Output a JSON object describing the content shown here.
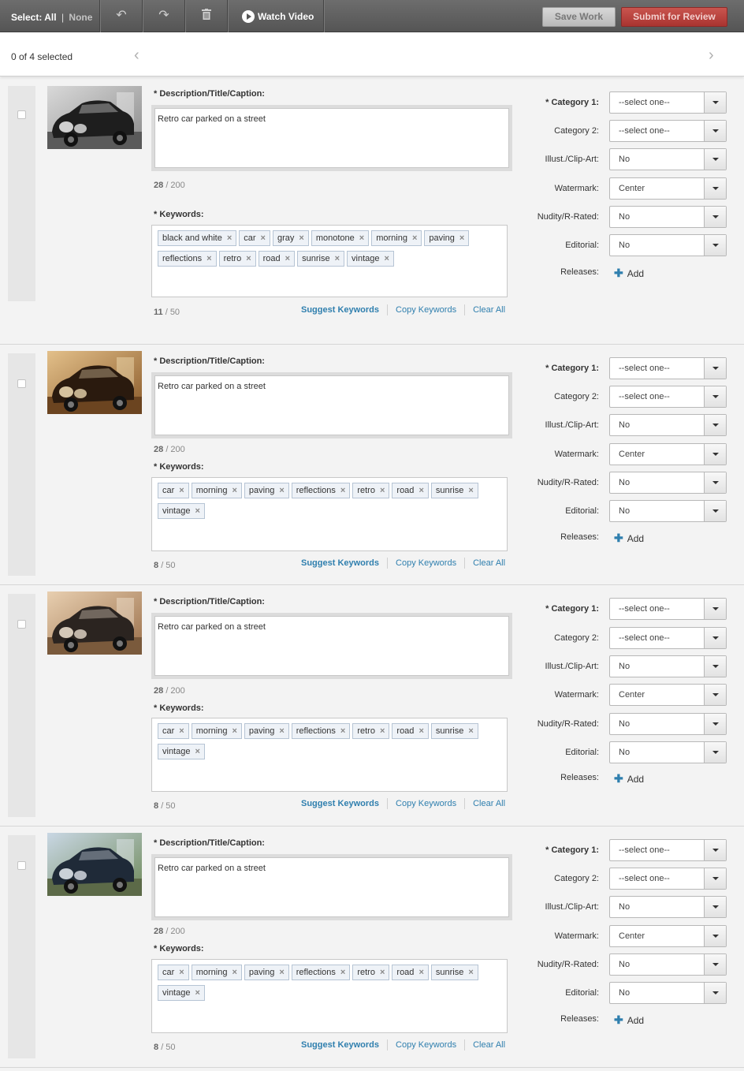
{
  "toolbar": {
    "select_label": "Select:",
    "select_all": "All",
    "select_divider": "|",
    "select_none": "None",
    "undo_icon": "↶",
    "redo_icon": "↷",
    "trash_icon": "🗑",
    "watch_video": "Watch Video",
    "save_work": "Save Work",
    "submit_review": "Submit for Review"
  },
  "selection": {
    "count_text": "0 of 4 selected",
    "prev": "‹",
    "next": "›"
  },
  "labels": {
    "description": "* Description/Title/Caption:",
    "keywords": "* Keywords:",
    "suggest": "Suggest Keywords",
    "copy": "Copy Keywords",
    "clear": "Clear All",
    "category1": "* Category 1:",
    "category2": "Category 2:",
    "illust": "Illust./Clip-Art:",
    "watermark": "Watermark:",
    "nudity": "Nudity/R-Rated:",
    "editorial": "Editorial:",
    "releases": "Releases:",
    "add": "Add",
    "remove_x": "×",
    "plus": "✚"
  },
  "items": [
    {
      "description": "Retro car parked on a street",
      "desc_count": "28",
      "desc_max": "/ 200",
      "keywords": [
        "black and white",
        "car",
        "gray",
        "monotone",
        "morning",
        "paving",
        "reflections",
        "retro",
        "road",
        "sunrise",
        "vintage"
      ],
      "kw_count": "11",
      "kw_max": "/ 50",
      "category1": "--select one--",
      "category2": "--select one--",
      "illust": "No",
      "watermark": "Center",
      "nudity": "No",
      "editorial": "No"
    },
    {
      "description": "Retro car parked on a street",
      "desc_count": "28",
      "desc_max": "/ 200",
      "keywords": [
        "car",
        "morning",
        "paving",
        "reflections",
        "retro",
        "road",
        "sunrise",
        "vintage"
      ],
      "kw_count": "8",
      "kw_max": "/ 50",
      "category1": "--select one--",
      "category2": "--select one--",
      "illust": "No",
      "watermark": "Center",
      "nudity": "No",
      "editorial": "No"
    },
    {
      "description": "Retro car parked on a street",
      "desc_count": "28",
      "desc_max": "/ 200",
      "keywords": [
        "car",
        "morning",
        "paving",
        "reflections",
        "retro",
        "road",
        "sunrise",
        "vintage"
      ],
      "kw_count": "8",
      "kw_max": "/ 50",
      "category1": "--select one--",
      "category2": "--select one--",
      "illust": "No",
      "watermark": "Center",
      "nudity": "No",
      "editorial": "No"
    },
    {
      "description": "Retro car parked on a street",
      "desc_count": "28",
      "desc_max": "/ 200",
      "keywords": [
        "car",
        "morning",
        "paving",
        "reflections",
        "retro",
        "road",
        "sunrise",
        "vintage"
      ],
      "kw_count": "8",
      "kw_max": "/ 50",
      "category1": "--select one--",
      "category2": "--select one--",
      "illust": "No",
      "watermark": "Center",
      "nudity": "No",
      "editorial": "No"
    }
  ],
  "colors": {
    "accent_link": "#2f7fae",
    "submit": "#b03a35",
    "toolbar": "#5f5f5f"
  },
  "thumb_tones": [
    "grayscale",
    "sepia",
    "warm",
    "color"
  ]
}
